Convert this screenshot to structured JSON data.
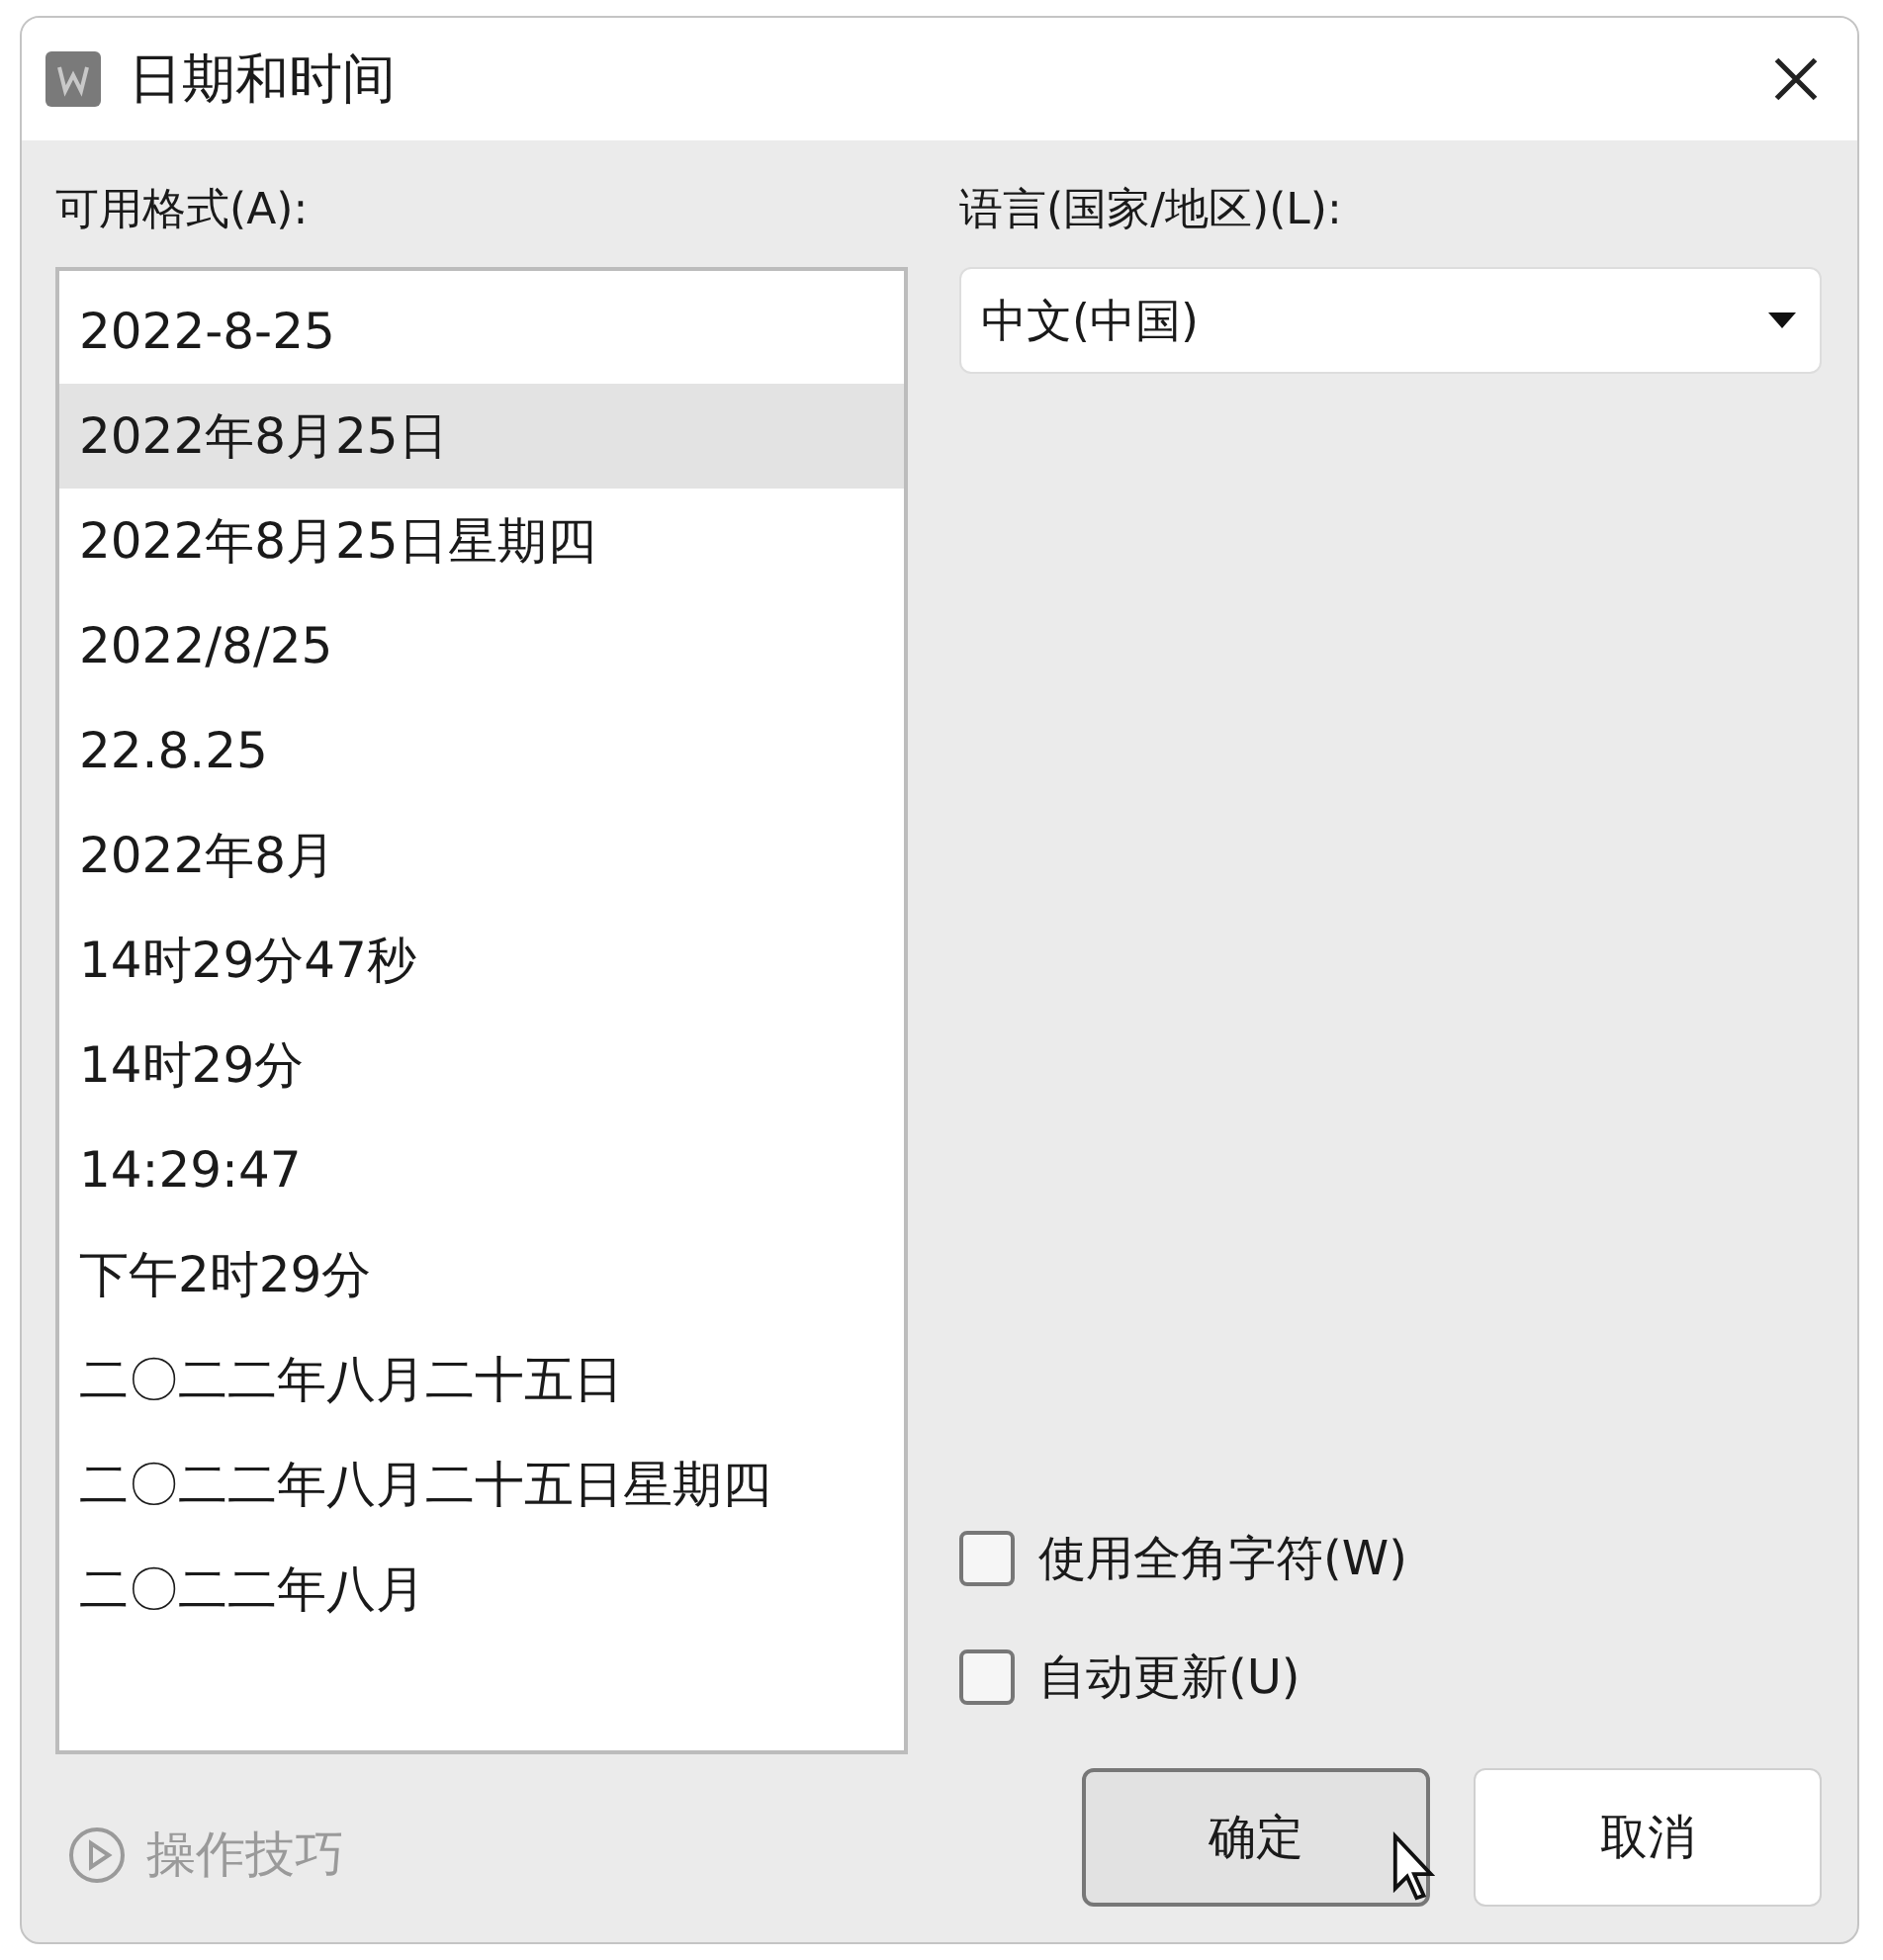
{
  "window": {
    "title": "日期和时间"
  },
  "formats": {
    "label": "可用格式(A):",
    "items": [
      {
        "text": "2022-8-25",
        "selected": false
      },
      {
        "text": "2022年8月25日",
        "selected": true
      },
      {
        "text": "2022年8月25日星期四",
        "selected": false
      },
      {
        "text": "2022/8/25",
        "selected": false
      },
      {
        "text": "22.8.25",
        "selected": false
      },
      {
        "text": "2022年8月",
        "selected": false
      },
      {
        "text": "14时29分47秒",
        "selected": false
      },
      {
        "text": "14时29分",
        "selected": false
      },
      {
        "text": "14:29:47",
        "selected": false
      },
      {
        "text": "下午2时29分",
        "selected": false
      },
      {
        "text": "二〇二二年八月二十五日",
        "selected": false
      },
      {
        "text": "二〇二二年八月二十五日星期四",
        "selected": false
      },
      {
        "text": "二〇二二年八月",
        "selected": false
      }
    ]
  },
  "language": {
    "label": "语言(国家/地区)(L):",
    "value": "中文(中国)"
  },
  "options": [
    {
      "label": "使用全角字符(W)",
      "checked": false
    },
    {
      "label": "自动更新(U)",
      "checked": false
    }
  ],
  "tips_link": "操作技巧",
  "buttons": [
    "确定",
    "取消"
  ]
}
